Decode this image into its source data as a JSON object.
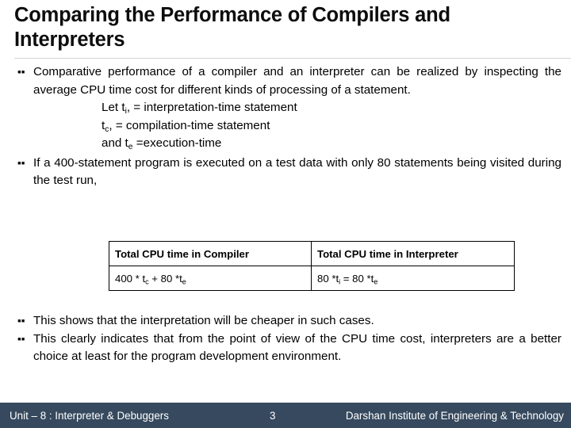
{
  "slide": {
    "title": "Comparing the Performance of Compilers and Interpreters",
    "bullets_top": [
      {
        "marker": "▪",
        "text": "Comparative performance of a compiler and an interpreter can be realized by inspecting the average CPU time cost for different kinds of processing of a statement."
      },
      {
        "marker": "▪",
        "text": "If a 400-statement program is executed on a test data with only 80 statements being visited during the test run,"
      }
    ],
    "definitions": [
      {
        "prefix": "Let t",
        "sub": "i",
        "suffix": ", = interpretation-time statement"
      },
      {
        "prefix": "t",
        "sub": "c",
        "suffix": ", = compilation-time statement"
      },
      {
        "prefix": "and t",
        "sub": "e",
        "suffix": " =execution-time"
      }
    ],
    "table": {
      "headers": [
        "Total CPU time in Compiler",
        "Total CPU time in Interpreter"
      ],
      "rows": [
        [
          {
            "segments": [
              {
                "t": "400 * t"
              },
              {
                "sub": "c"
              },
              {
                "t": " + 80 *t"
              },
              {
                "sub": "e"
              }
            ]
          },
          {
            "segments": [
              {
                "t": "80 *t"
              },
              {
                "sub": "i"
              },
              {
                "t": " = 80 *t"
              },
              {
                "sub": "e"
              }
            ]
          }
        ]
      ]
    },
    "bullets_bottom": [
      {
        "marker": "▪",
        "text": "This shows that the interpretation will be cheaper in such cases."
      },
      {
        "marker": "▪",
        "text": "This clearly indicates that from the point of view of the CPU time cost, interpreters are a better choice at least for the program development environment."
      }
    ]
  },
  "footer": {
    "left": "Unit – 8 : Interpreter & Debuggers",
    "page_number": "3",
    "right": "Darshan Institute of Engineering & Technology",
    "background_color": "#36495E",
    "text_color": "#ffffff"
  }
}
